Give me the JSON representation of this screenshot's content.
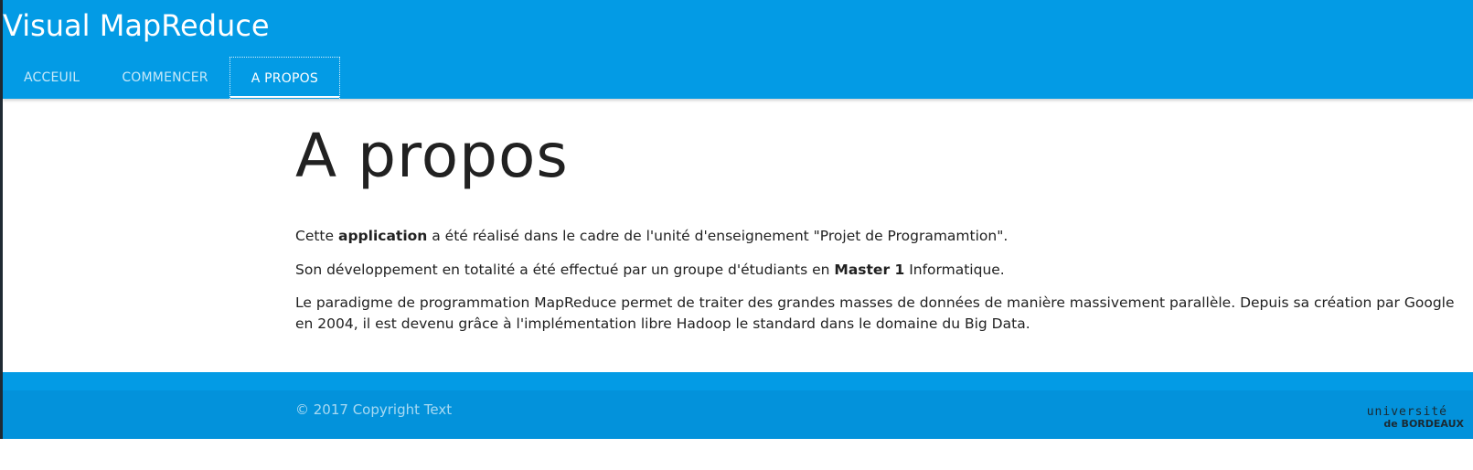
{
  "header": {
    "app_title": "Visual MapReduce",
    "tabs": [
      {
        "label": "ACCEUIL",
        "active": false
      },
      {
        "label": "COMMENCER",
        "active": false
      },
      {
        "label": "A PROPOS",
        "active": true
      }
    ]
  },
  "main": {
    "title": "A propos",
    "p1": {
      "a": "Cette ",
      "b": "application",
      "c": " a été réalisé dans le cadre de l'unité d'enseignement \"Projet de Programamtion\"."
    },
    "p2": {
      "a": "Son développement en totalité a été effectué par un groupe d'étudiants en ",
      "b": "Master 1",
      "c": " Informatique."
    },
    "p3": "Le paradigme de programmation MapReduce permet de traiter des grandes masses de données de manière massivement parallèle. Depuis sa création par Google en 2004, il est devenu grâce à l'implémentation libre Hadoop le standard dans le domaine du Big Data."
  },
  "footer": {
    "copyright": "© 2017 Copyright Text",
    "logo": {
      "line1": "université",
      "line2": "de BORDEAUX"
    }
  },
  "colors": {
    "primary": "#039be5",
    "footer": "#0392db",
    "text": "#212121"
  }
}
